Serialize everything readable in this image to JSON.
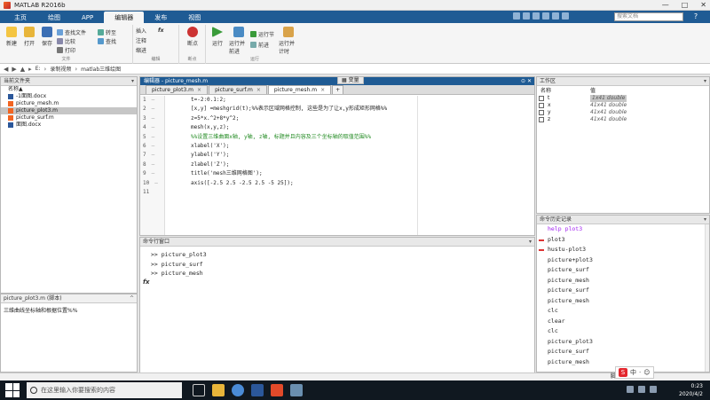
{
  "window": {
    "title": "MATLAB R2016b",
    "controls": [
      "—",
      "□",
      "✕"
    ]
  },
  "ribbon_tabs": [
    "主页",
    "绘图",
    "APP",
    "编辑器",
    "发布",
    "视图"
  ],
  "active_tab": "编辑器",
  "search_placeholder": "搜索文档",
  "ribbon": {
    "file": {
      "new": "新建",
      "open": "打开",
      "save": "保存",
      "label": "文件"
    },
    "compare": "比较",
    "print": "打印",
    "find_files": "查找文件",
    "nav": {
      "goto": "转至",
      "find": "查找",
      "label": "导航"
    },
    "edit": {
      "insert": "插入",
      "comment": "注释",
      "indent": "缩进",
      "label": "编辑"
    },
    "breakpoints": {
      "label": "断点",
      "btn": "断点"
    },
    "run": {
      "run": "运行",
      "run_advance": "运行并前进",
      "run_section": "运行节",
      "advance": "前进",
      "run_time": "运行并计时",
      "label": "运行"
    }
  },
  "path": [
    "E:",
    "录制视频",
    "matlab三维绘图"
  ],
  "current_folder": {
    "title": "当前文件夹",
    "col": "名称",
    "files": [
      {
        "name": "-1面图.docx",
        "color": "#2b579a"
      },
      {
        "name": "picture_mesh.m",
        "color": "#f26522"
      },
      {
        "name": "picture_plot3.m",
        "color": "#f26522"
      },
      {
        "name": "picture_surf.m",
        "color": "#f26522"
      },
      {
        "name": "面图.docx",
        "color": "#2b579a"
      }
    ],
    "selected": 2
  },
  "details": {
    "title": "picture_plot3.m  (脚本)",
    "desc": "三维曲线坐标轴和根据位置%%"
  },
  "editor": {
    "title": "编辑器 - picture_mesh.m",
    "tabs": [
      "picture_plot3.m",
      "picture_surf.m",
      "picture_mesh.m"
    ],
    "active": 2,
    "plus": "+",
    "variables_tab": "变量",
    "code": [
      {
        "n": "1",
        "t": "t=-2:0.1:2;",
        "c": false
      },
      {
        "n": "2",
        "t": "[x,y] =meshgrid(t);%%表示区域网格控制, 这些是为了让x,y形成矩形网格%%",
        "c": false
      },
      {
        "n": "3",
        "t": "z=5*x.^2+8*y^2;",
        "c": false
      },
      {
        "n": "4",
        "t": "mesh(x,y,z);",
        "c": false
      },
      {
        "n": "5",
        "t": "%%设置三维曲面x轴, y轴, z轴, 标题并且内容及三个坐标轴的取值范围%%",
        "c": true
      },
      {
        "n": "6",
        "t": "xlabel('X');",
        "c": false
      },
      {
        "n": "7",
        "t": "ylabel('Y');",
        "c": false
      },
      {
        "n": "8",
        "t": "zlabel('Z');",
        "c": false
      },
      {
        "n": "9",
        "t": "title('mesh三维网格图');",
        "c": false
      },
      {
        "n": "10",
        "t": "axis([-2.5 2.5 -2.5 2.5 -5 25]);",
        "c": false
      },
      {
        "n": "11",
        "t": "",
        "c": false
      }
    ]
  },
  "command_window": {
    "title": "命令行窗口",
    "lines": [
      ">> picture_plot3",
      ">> picture_surf",
      ">> picture_mesh"
    ],
    "prompt": "fx"
  },
  "workspace": {
    "title": "工作区",
    "cols": [
      "名称",
      "值"
    ],
    "vars": [
      {
        "name": "t",
        "value": "1x41 double"
      },
      {
        "name": "x",
        "value": "41x41 double"
      },
      {
        "name": "y",
        "value": "41x41 double"
      },
      {
        "name": "z",
        "value": "41x41 double"
      }
    ]
  },
  "history": {
    "title": "命令历史记录",
    "items": [
      "help plot3",
      "plot3",
      "hustu-plot3",
      "picture+plot3",
      "picture_surf",
      "picture_mesh",
      "picture_surf",
      "picture_mesh",
      "clc",
      "clear",
      "clc",
      "picture_plot3",
      "picture_surf",
      "picture_mesh"
    ]
  },
  "status": {
    "right": "脚本"
  },
  "taskbar": {
    "search_placeholder": "在这里输入你要搜索的内容",
    "time": "0:23",
    "date": "2020/4/2"
  },
  "ime": {
    "labels": [
      "中",
      "·",
      "☺"
    ]
  }
}
